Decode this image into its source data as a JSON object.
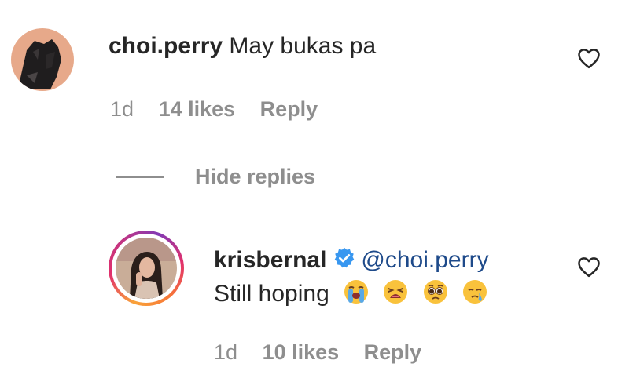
{
  "comment": {
    "username": "choi.perry",
    "text": "May bukas pa",
    "time": "1d",
    "likes": "14 likes",
    "reply_label": "Reply",
    "avatar_icon": "avatar-dark-figure",
    "like_icon": "heart-outline-icon"
  },
  "replies_toggle": {
    "label": "Hide replies"
  },
  "reply": {
    "username": "krisbernal",
    "verified_icon": "verified-badge-icon",
    "mention": "@choi.perry",
    "text": "Still hoping",
    "emojis": [
      "loudly-crying-face",
      "tired-face",
      "pleading-face",
      "face-holding-back-tears"
    ],
    "time": "1d",
    "likes": "10 likes",
    "reply_label": "Reply",
    "avatar_icon": "avatar-woman-photo",
    "like_icon": "heart-outline-icon"
  },
  "colors": {
    "text": "#262626",
    "meta": "#8e8e8e",
    "mention": "#1e4a8a",
    "verified": "#3897f0"
  }
}
